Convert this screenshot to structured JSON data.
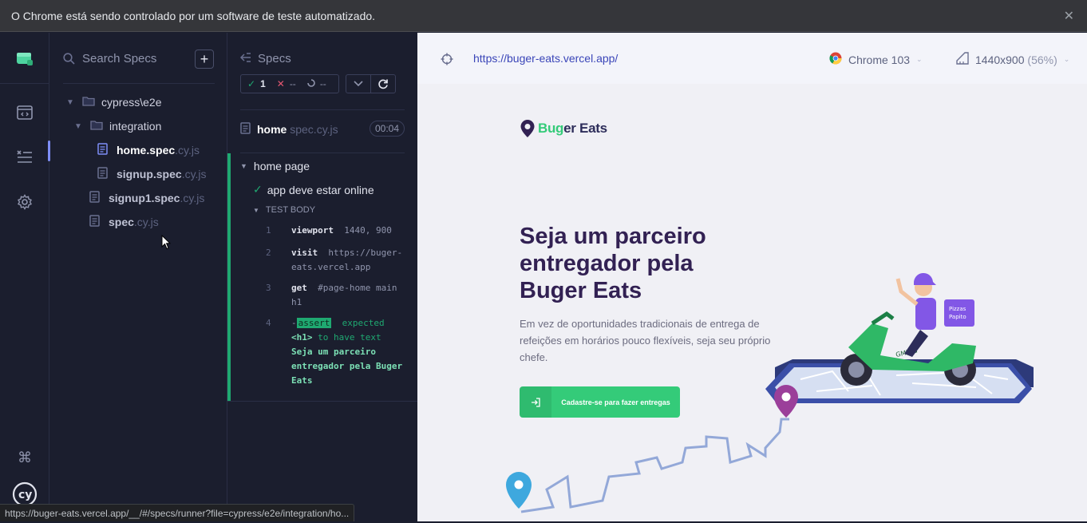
{
  "infobar": {
    "message": "O Chrome está sendo controlado por um software de teste automatizado."
  },
  "rail": {
    "items": [
      "cypress-logo",
      "specs",
      "runs",
      "settings",
      "keyboard-shortcuts",
      "cy-logo"
    ]
  },
  "specs_list": {
    "search_placeholder": "Search Specs",
    "add_label": "+",
    "tree": [
      {
        "type": "folder",
        "name": "cypress\\e2e",
        "ext": ""
      },
      {
        "type": "folder",
        "name": "integration",
        "ext": ""
      },
      {
        "type": "file",
        "name": "home.spec",
        "ext": ".cy.js",
        "active": true
      },
      {
        "type": "file",
        "name": "signup.spec",
        "ext": ".cy.js"
      },
      {
        "type": "file",
        "name": "signup1.spec",
        "ext": ".cy.js"
      },
      {
        "type": "file",
        "name": "spec",
        "ext": ".cy.js"
      }
    ]
  },
  "reporter": {
    "header": "Specs",
    "stats": {
      "passed": "1",
      "failed": "--",
      "pending": "--"
    },
    "spec": {
      "name": "home",
      "ext": " spec.cy.js",
      "duration": "00:04"
    },
    "suite": "home page",
    "test": "app deve estar online",
    "test_body_label": "TEST BODY",
    "commands": [
      {
        "num": "1",
        "name": "viewport",
        "arg": "1440, 900"
      },
      {
        "num": "2",
        "name": "visit",
        "arg": "https://buger-eats.vercel.app"
      },
      {
        "num": "3",
        "name": "get",
        "arg": "#page-home main h1"
      },
      {
        "num": "4",
        "prefix": "-",
        "badge": "assert",
        "text1": "expected",
        "code": "<h1>",
        "text2": "to have text",
        "value": "Seja um parceiro entregador pela Buger Eats"
      }
    ]
  },
  "aut": {
    "url": "https://buger-eats.vercel.app/",
    "browser": "Chrome 103",
    "viewport": "1440x900",
    "scale": "(56%)"
  },
  "page": {
    "logo_part1": "Bug",
    "logo_part2": "er Eats",
    "title": "Seja um parceiro entregador pela Buger Eats",
    "description": "Em vez de oportunidades tradicionais de entrega de refeições em horários pouco flexíveis, seja seu próprio chefe.",
    "cta": "Cadastre-se para fazer entregas",
    "box_text_1": "Pizzas",
    "box_text_2": "Papito",
    "scooter_text": "GMinja"
  },
  "status_bar": {
    "url": "https://buger-eats.vercel.app/__/#/specs/runner?file=cypress/e2e/integration/ho..."
  },
  "colors": {
    "green": "#34cb79",
    "purple": "#322153",
    "link": "#3a45b8",
    "pass": "#1fa971",
    "rail_active": "#7e8ef7"
  }
}
